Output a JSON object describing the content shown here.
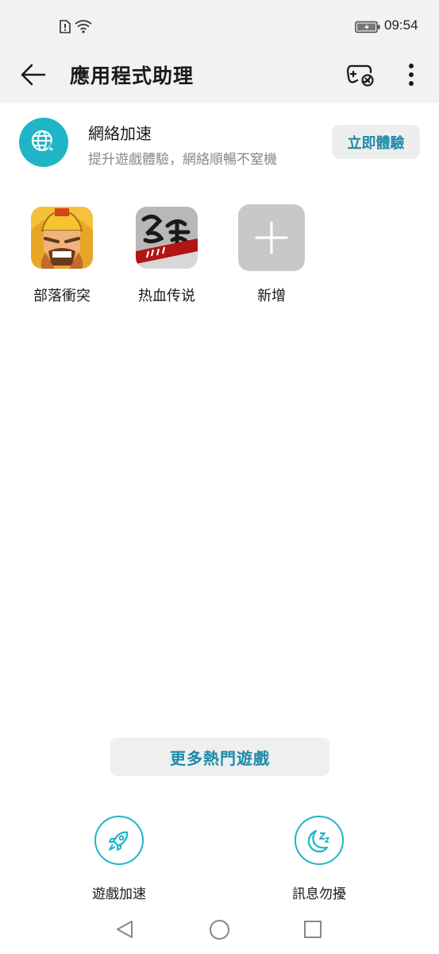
{
  "status_bar": {
    "time": "09:54",
    "icons": [
      "sim-icon",
      "wifi-icon",
      "battery-icon"
    ]
  },
  "app_bar": {
    "title": "應用程式助理",
    "icons": [
      "back-arrow-icon",
      "gamepad-icon",
      "more-vert-icon"
    ]
  },
  "network_card": {
    "title": "網絡加速",
    "subtitle": "提升遊戲體驗，網絡順暢不窒機",
    "button_label": "立即體驗",
    "icon": "globe-bolt-icon"
  },
  "games": [
    {
      "label": "部落衝突",
      "icon": "clash-of-clans-icon"
    },
    {
      "label": "热血传说",
      "icon": "rexue-chuanshuo-icon"
    }
  ],
  "add_game": {
    "label": "新增",
    "icon": "plus-icon"
  },
  "more_games_button": "更多熱門遊戲",
  "features": [
    {
      "label": "遊戲加速",
      "icon": "rocket-icon"
    },
    {
      "label": "訊息勿擾",
      "icon": "moon-icon"
    }
  ],
  "colors": {
    "accent": "#1fb5c6",
    "accent_text": "#1d8aa8",
    "header_bg": "#f2f2f2"
  },
  "nav_bar": {
    "icons": [
      "nav-back-icon",
      "nav-home-icon",
      "nav-recent-icon"
    ]
  }
}
